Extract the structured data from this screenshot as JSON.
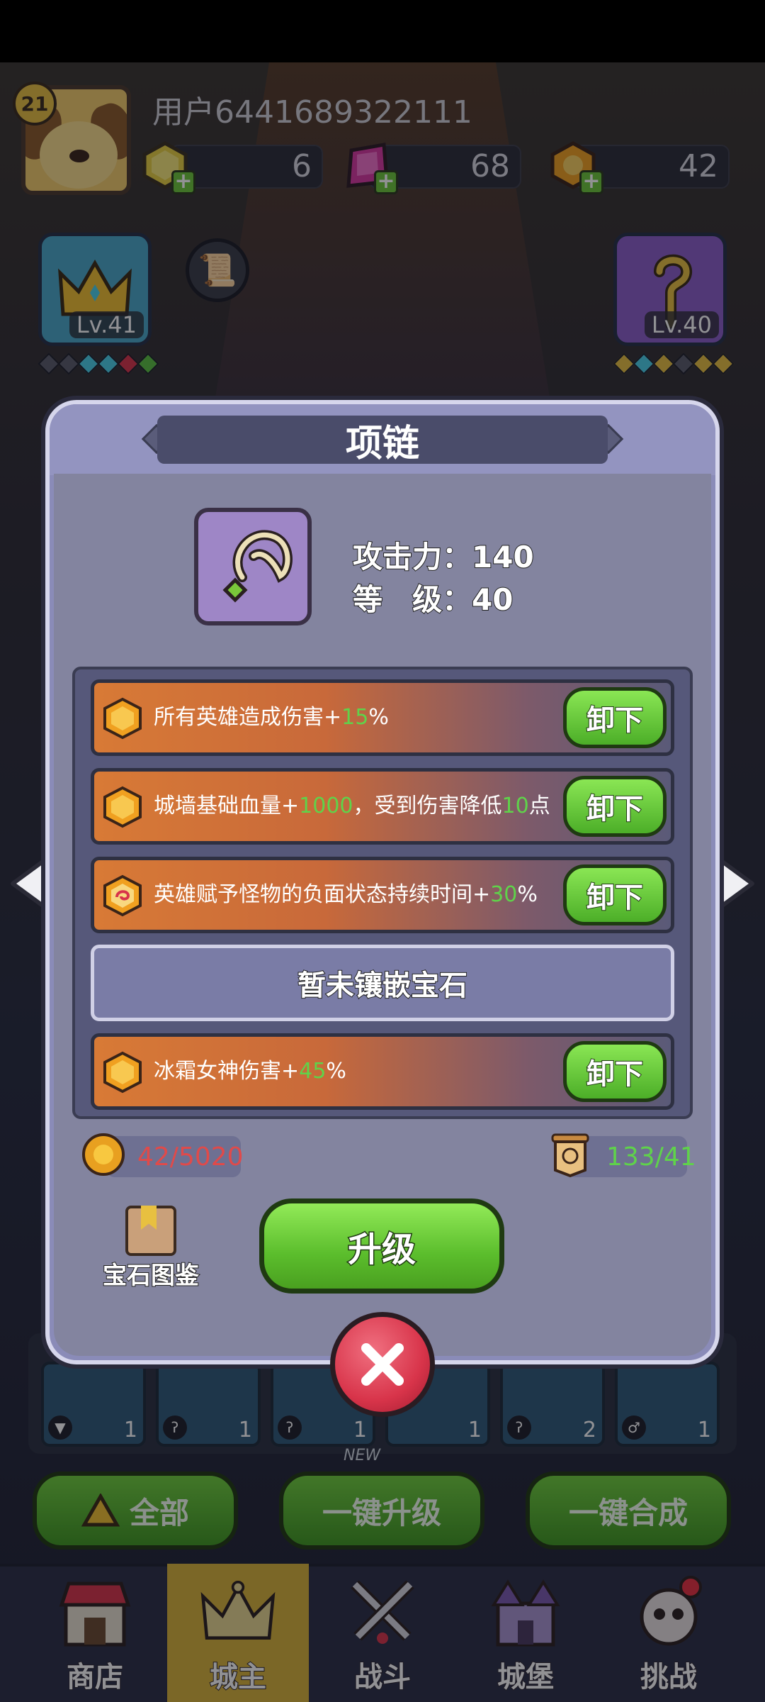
{
  "player": {
    "level": "21",
    "username": "用户6441689322111",
    "resources": [
      {
        "name": "gold-ingot",
        "value": "6",
        "color": "#e8d040"
      },
      {
        "name": "pink-gem",
        "value": "68",
        "color": "#d838a0"
      },
      {
        "name": "orange-gem",
        "value": "42",
        "color": "#f0a020"
      }
    ]
  },
  "heroes": {
    "left": {
      "level": "Lv.41",
      "icon": "crown-icon"
    },
    "right": {
      "level": "Lv.40",
      "icon": "staff-icon"
    }
  },
  "dialog": {
    "title": "项链",
    "item_icon": "necklace-icon",
    "attack_label": "攻击力：",
    "attack_value": "140",
    "level_label": "等　级：",
    "level_value": "40",
    "gems": [
      {
        "pre": "所有英雄造成伤害+",
        "hl": "15",
        "post": "%",
        "hl2": "",
        "post2": "",
        "button": "卸下",
        "icon": "hexagon-gem-icon"
      },
      {
        "pre": "城墙基础血量+",
        "hl": "1000",
        "post": "，受到伤害降低",
        "hl2": "10",
        "post2": "点",
        "button": "卸下",
        "icon": "hexagon-gem-icon"
      },
      {
        "pre": "英雄赋予怪物的负面状态持续时间+",
        "hl": "30",
        "post": "%",
        "hl2": "",
        "post2": "",
        "button": "卸下",
        "icon": "swirl-gem-icon"
      },
      {
        "pre": "冰霜女神伤害+",
        "hl": "45",
        "post": "%",
        "hl2": "",
        "post2": "",
        "button": "卸下",
        "icon": "hexagon-gem-icon"
      }
    ],
    "empty_slot": "暂未镶嵌宝石",
    "gold_cost": "42/5020",
    "scroll_cost": "133/41",
    "codex_label": "宝石图鉴",
    "upgrade_label": "升级",
    "colors": {
      "highlight": "#5fd34a",
      "insufficient": "#e04a4a"
    }
  },
  "inventory_counts": [
    "1",
    "1",
    "1",
    "1",
    "2",
    "1"
  ],
  "new_label": "NEW",
  "bottom_buttons": {
    "all": "全部",
    "upgrade_all": "一键升级",
    "merge_all": "一键合成"
  },
  "nav": [
    {
      "label": "商店",
      "icon": "shop-icon",
      "active": false
    },
    {
      "label": "城主",
      "icon": "crown-icon",
      "active": true
    },
    {
      "label": "战斗",
      "icon": "swords-icon",
      "active": false
    },
    {
      "label": "城堡",
      "icon": "castle-icon",
      "active": false
    },
    {
      "label": "挑战",
      "icon": "challenge-icon",
      "active": false
    }
  ]
}
